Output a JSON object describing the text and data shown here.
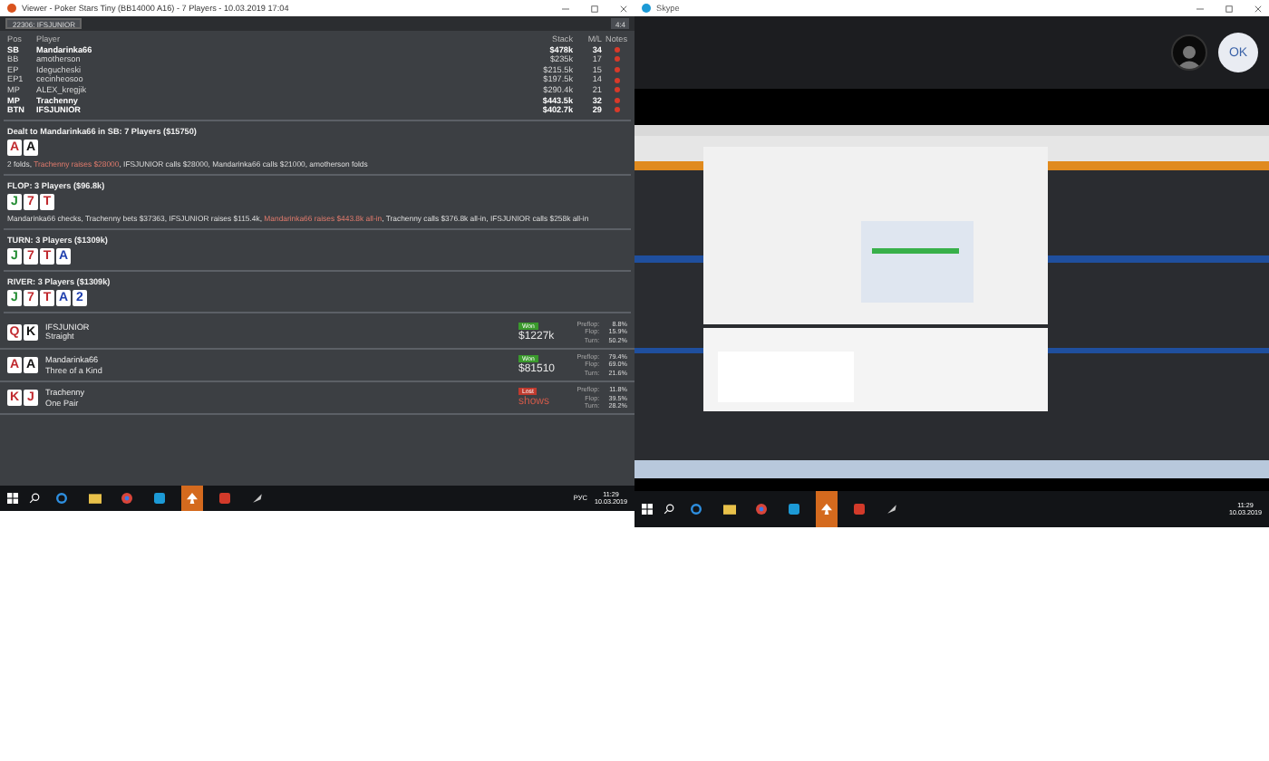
{
  "viewer": {
    "title": "Viewer - Poker Stars Tiny (BB14000 A16) - 7 Players - 10.03.2019 17:04",
    "player_select": "22306: IFSJUNIOR",
    "zoom_label": "4:4",
    "columns": [
      "Pos",
      "Player",
      "Stack",
      "M/L",
      "Notes"
    ],
    "players": [
      {
        "pos": "SB",
        "name": "Mandarinka66",
        "stack": "$478k",
        "ml": "34",
        "in_hand": true
      },
      {
        "pos": "BB",
        "name": "amotherson",
        "stack": "$235k",
        "ml": "17",
        "in_hand": false
      },
      {
        "pos": "EP",
        "name": "Idegucheski",
        "stack": "$215.5k",
        "ml": "15",
        "in_hand": false
      },
      {
        "pos": "EP1",
        "name": "cecinheosoo",
        "stack": "$197.5k",
        "ml": "14",
        "in_hand": false
      },
      {
        "pos": "MP",
        "name": "ALEX_kregjik",
        "stack": "$290.4k",
        "ml": "21",
        "in_hand": false
      },
      {
        "pos": "MP",
        "name": "Trachenny",
        "stack": "$443.5k",
        "ml": "32",
        "in_hand": true
      },
      {
        "pos": "BTN",
        "name": "IFSJUNIOR",
        "stack": "$402.7k",
        "ml": "29",
        "in_hand": true
      }
    ],
    "streets": [
      {
        "heading": "Dealt to Mandarinka66 in SB: 7 Players ($15750)",
        "cards": [
          {
            "rank": "A",
            "color": "#c0282d"
          },
          {
            "rank": "A",
            "color": "#111111"
          }
        ],
        "actions": [
          {
            "text": "2 folds, ",
            "highlight": false
          },
          {
            "text": "Trachenny raises $28000",
            "highlight": true
          },
          {
            "text": ", IFSJUNIOR calls $28000, Mandarinka66 calls $21000, amotherson folds",
            "highlight": false
          }
        ]
      },
      {
        "heading": "FLOP: 3 Players ($96.8k)",
        "cards": [
          {
            "rank": "J",
            "color": "#1e8a2e"
          },
          {
            "rank": "7",
            "color": "#c0282d"
          },
          {
            "rank": "T",
            "color": "#c0282d"
          }
        ],
        "actions": [
          {
            "text": "Mandarinka66 checks, Trachenny bets $37363, IFSJUNIOR raises $115.4k, ",
            "highlight": false
          },
          {
            "text": "Mandarinka66 raises $443.8k all-in",
            "highlight": true
          },
          {
            "text": ", Trachenny calls $376.8k all-in, IFSJUNIOR calls $258k all-in",
            "highlight": false
          }
        ]
      },
      {
        "heading": "TURN: 3 Players ($1309k)",
        "cards": [
          {
            "rank": "J",
            "color": "#1e8a2e"
          },
          {
            "rank": "7",
            "color": "#c0282d"
          },
          {
            "rank": "T",
            "color": "#c0282d"
          },
          {
            "rank": "A",
            "color": "#1f3fae"
          }
        ]
      },
      {
        "heading": "RIVER: 3 Players ($1309k)",
        "cards": [
          {
            "rank": "J",
            "color": "#1e8a2e"
          },
          {
            "rank": "7",
            "color": "#c0282d"
          },
          {
            "rank": "T",
            "color": "#c0282d"
          },
          {
            "rank": "A",
            "color": "#1f3fae"
          },
          {
            "rank": "2",
            "color": "#1f3fae"
          }
        ]
      }
    ],
    "results": [
      {
        "cards": [
          {
            "rank": "Q",
            "color": "#c0282d"
          },
          {
            "rank": "K",
            "color": "#111111"
          }
        ],
        "name": "IFSJUNIOR",
        "hand": "Straight",
        "kind": "won",
        "outcome": "Won",
        "amount": "$1227k",
        "equity": [
          {
            "label": "Preflop:",
            "value": "8.8%"
          },
          {
            "label": "Flop:",
            "value": "15.9%"
          },
          {
            "label": "Turn:",
            "value": "50.2%"
          }
        ]
      },
      {
        "cards": [
          {
            "rank": "A",
            "color": "#c0282d"
          },
          {
            "rank": "A",
            "color": "#111111"
          }
        ],
        "name": "Mandarinka66",
        "hand": "Three of a Kind",
        "kind": "won",
        "outcome": "Won",
        "amount": "$81510",
        "equity": [
          {
            "label": "Preflop:",
            "value": "79.4%"
          },
          {
            "label": "Flop:",
            "value": "69.0%"
          },
          {
            "label": "Turn:",
            "value": "21.6%"
          }
        ]
      },
      {
        "cards": [
          {
            "rank": "K",
            "color": "#c0282d"
          },
          {
            "rank": "J",
            "color": "#c0282d"
          }
        ],
        "name": "Trachenny",
        "hand": "One Pair",
        "kind": "lost",
        "outcome": "Lost",
        "amount": "shows",
        "equity": [
          {
            "label": "Preflop:",
            "value": "11.8%"
          },
          {
            "label": "Flop:",
            "value": "39.5%"
          },
          {
            "label": "Turn:",
            "value": "28.2%"
          }
        ]
      }
    ]
  },
  "left_taskbar": {
    "apps": [
      {
        "kind": "edge",
        "active": false
      },
      {
        "kind": "folder",
        "active": false
      },
      {
        "kind": "chrome",
        "active": false
      },
      {
        "kind": "skype",
        "active": false
      },
      {
        "kind": "poker",
        "active": true
      },
      {
        "kind": "badge",
        "active": false
      },
      {
        "kind": "feather",
        "active": false
      }
    ],
    "language": "РУС",
    "time": "11:29",
    "date": "10.03.2019"
  },
  "skype": {
    "title": "Skype",
    "self_label": "OK"
  },
  "right_taskbar": {
    "apps": [
      {
        "kind": "edge",
        "active": false
      },
      {
        "kind": "folder",
        "active": false
      },
      {
        "kind": "chrome",
        "active": false
      },
      {
        "kind": "skype",
        "active": false
      },
      {
        "kind": "poker",
        "active": true
      },
      {
        "kind": "badge",
        "active": false
      },
      {
        "kind": "feather",
        "active": false
      }
    ],
    "time": "11:29",
    "date": "10.03.2019"
  }
}
